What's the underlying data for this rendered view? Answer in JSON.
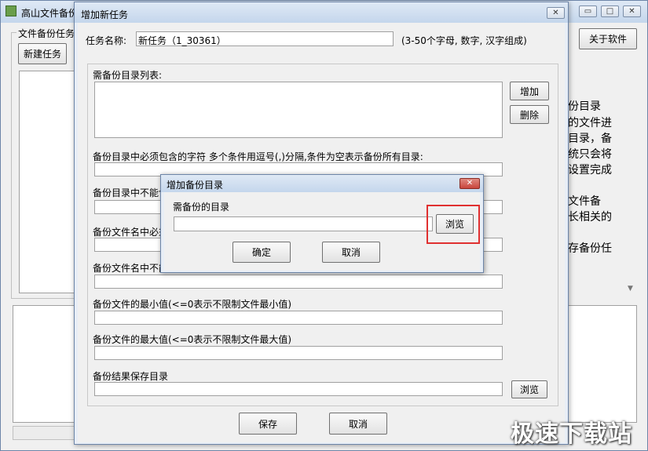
{
  "main_window": {
    "title": "高山文件备份",
    "group_label": "文件备份任务",
    "new_task_button": "新建任务",
    "about_button": "关于软件",
    "help_lines": [
      "份目录",
      "的文件进",
      "目录，备",
      "统只会将",
      "设置完成",
      "文件备",
      "长相关的",
      "存备份任"
    ]
  },
  "add_task_dialog": {
    "title": "增加新任务",
    "task_name_label": "任务名称:",
    "task_name_value": "新任务（1_30361）",
    "task_name_hint": "(3-50个字母, 数字, 汉字组成)",
    "dir_list_label": "需备份目录列表:",
    "add_button": "增加",
    "delete_button": "删除",
    "must_contain_dir_label": "备份目录中必须包含的字符 多个条件用逗号(,)分隔,条件为空表示备份所有目录:",
    "not_contain_dir_label": "备份目录中不能包",
    "must_contain_file_label": "备份文件名中必须",
    "not_contain_file_label": "备份文件名中不能",
    "min_size_label": "备份文件的最小值(<=0表示不限制文件最小值)",
    "max_size_label": "备份文件的最大值(<=0表示不限制文件最大值)",
    "result_dir_label": "备份结果保存目录",
    "browse_button": "浏览",
    "save_button": "保存",
    "cancel_button": "取消"
  },
  "add_dir_dialog": {
    "title": "增加备份目录",
    "dir_label": "需备份的目录",
    "dir_value": "",
    "browse_button": "浏览",
    "ok_button": "确定",
    "cancel_button": "取消"
  },
  "watermark": "极速下载站",
  "colors": {
    "highlight": "#e03030",
    "close_red": "#c9463d"
  }
}
